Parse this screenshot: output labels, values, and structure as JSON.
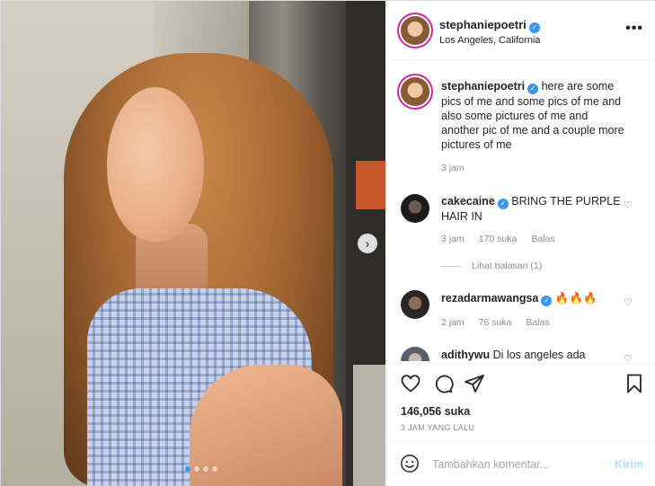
{
  "post": {
    "username": "stephaniepoetri",
    "location": "Los Angeles, California",
    "more_label": "•••"
  },
  "photo": {
    "carousel_dots": 4,
    "active_dot": 0,
    "next_icon": "chevron-right-icon"
  },
  "caption": {
    "username": "stephaniepoetri",
    "text": "here are some pics of me and some pics of me and also some pictures of me and another pic of me and a couple more pictures of me",
    "time": "3 jam"
  },
  "comments": [
    {
      "username": "cakecaine",
      "verified": true,
      "text": "BRING THE PURPLE HAIR IN",
      "time": "3 jam",
      "likes": "170 suka",
      "reply_label": "Balas",
      "view_replies": "Lihat balasan (1)"
    },
    {
      "username": "rezadarmawangsa",
      "verified": true,
      "text": "🔥🔥🔥",
      "time": "2 jam",
      "likes": "76 suka",
      "reply_label": "Balas"
    },
    {
      "username": "adithywu",
      "verified": false,
      "text": "Di los angeles ada"
    }
  ],
  "stats": {
    "likes": "146,056 suka",
    "time": "3 JAM YANG LALU"
  },
  "composer": {
    "placeholder": "Tambahkan komentar...",
    "post_label": "Kirim"
  },
  "colors": {
    "verified": "#3897f0",
    "story_ring": "#d6249f",
    "post_button_disabled": "#b2dffc"
  }
}
